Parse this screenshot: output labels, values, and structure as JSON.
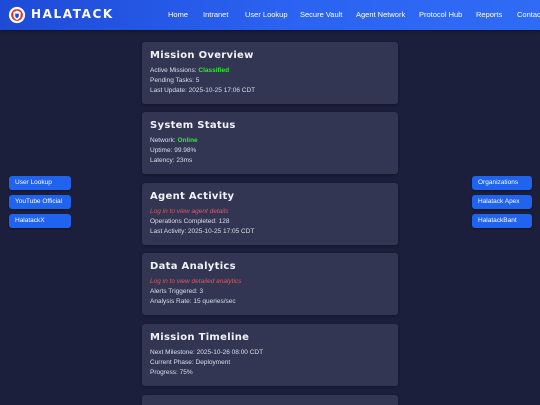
{
  "header": {
    "brand": "HALATACK",
    "nav": [
      "Home",
      "Intranet",
      "User Lookup",
      "Secure Vault",
      "Agent Network",
      "Protocol Hub",
      "Reports",
      "Contact"
    ]
  },
  "sidebar_left": [
    "User Lookup",
    "YouTube Official",
    "HalatackX"
  ],
  "sidebar_right": [
    "Organizations",
    "Halatack Apex",
    "HalatackBant"
  ],
  "cards": [
    {
      "title": "Mission Overview",
      "lines": [
        {
          "label": "Active Missions: ",
          "value": "Classified",
          "style": "good"
        },
        {
          "label": "Pending Tasks: 5"
        },
        {
          "label": "Last Update: 2025-10-25 17:06 CDT"
        }
      ]
    },
    {
      "title": "System Status",
      "lines": [
        {
          "label": "Network: ",
          "value": "Online",
          "style": "good"
        },
        {
          "label": "Uptime: 99.98%"
        },
        {
          "label": "Latency: 23ms"
        }
      ]
    },
    {
      "title": "Agent Activity",
      "lines": [
        {
          "label": "Log in to view agent details",
          "style": "warn"
        },
        {
          "label": "Operations Completed: 128"
        },
        {
          "label": "Last Activity: 2025-10-25 17:05 CDT"
        }
      ]
    },
    {
      "title": "Data Analytics",
      "lines": [
        {
          "label": "Log in to view detailed analytics",
          "style": "warn"
        },
        {
          "label": "Alerts Triggered: 3"
        },
        {
          "label": "Analysis Rate: 15 queries/sec"
        }
      ]
    },
    {
      "title": "Mission Timeline",
      "lines": [
        {
          "label": "Next Milestone: 2025-10-26 08:00 CDT"
        },
        {
          "label": "Current Phase: Deployment"
        },
        {
          "label": "Progress: 75%"
        }
      ]
    }
  ],
  "colors": {
    "header": "#2c63f2",
    "page_bg": "#1c1f3b",
    "card_bg": "#333653",
    "button": "#1f63ee",
    "status_good": "#2ee82e",
    "login_notice": "#e05560"
  },
  "icons": {
    "logo": "halatack-shield-icon"
  }
}
